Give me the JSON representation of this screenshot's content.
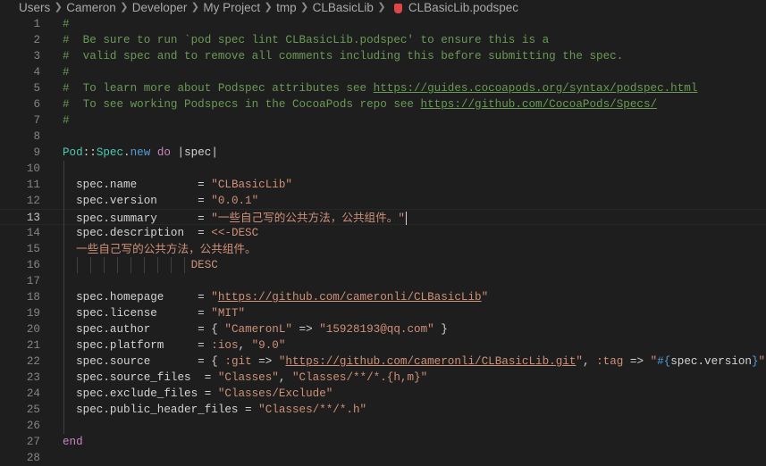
{
  "breadcrumb": {
    "items": [
      "Users",
      "Cameron",
      "Developer",
      "My Project",
      "tmp",
      "CLBasicLib"
    ],
    "file": "CLBasicLib.podspec",
    "file_icon": "ruby-file-icon",
    "file_icon_color": "#e0454a"
  },
  "editor": {
    "current_line": 13,
    "lines": [
      {
        "n": "1",
        "html": "<span class='cm'>#</span>"
      },
      {
        "n": "2",
        "html": "<span class='cm'>#  Be sure to run `pod spec lint CLBasicLib.podspec' to ensure this is a</span>"
      },
      {
        "n": "3",
        "html": "<span class='cm'>#  valid spec and to remove all comments including this before submitting the spec.</span>"
      },
      {
        "n": "4",
        "html": "<span class='cm'>#</span>"
      },
      {
        "n": "5",
        "html": "<span class='cm'>#  To learn more about Podspec attributes see </span><span class='url'>https://guides.cocoapods.org/syntax/podspec.html</span>"
      },
      {
        "n": "6",
        "html": "<span class='cm'>#  To see working Podspecs in the CocoaPods repo see </span><span class='url'>https://github.com/CocoaPods/Specs/</span>"
      },
      {
        "n": "7",
        "html": "<span class='cm'>#</span>"
      },
      {
        "n": "8",
        "html": ""
      },
      {
        "n": "9",
        "html": "<span class='cls'>Pod</span>::<span class='cls'>Spec</span>.<span class='blue'>new</span> <span class='kw'>do</span> |spec|"
      },
      {
        "n": "10",
        "html": ""
      },
      {
        "n": "11",
        "html": "  spec.name         = <span class='str'>\"CLBasicLib\"</span>"
      },
      {
        "n": "12",
        "html": "  spec.version      = <span class='str'>\"0.0.1\"</span>"
      },
      {
        "n": "13",
        "html": "  spec.summary      = <span class='str'>\"<span class='cjk'>一些自己写的公共方法，公共组件。</span>\"</span><span class='caret'></span>"
      },
      {
        "n": "14",
        "html": "  spec.description  = <span class='str'>&lt;&lt;-DESC</span>"
      },
      {
        "n": "15",
        "html": "<span class='str'>  <span class='cjk'>一些自己写的公共方法，公共组件。</span></span>"
      },
      {
        "n": "16",
        "html": "<span class='str'>                   DESC</span>"
      },
      {
        "n": "17",
        "html": ""
      },
      {
        "n": "18",
        "html": "  spec.homepage     = <span class='str'>\"</span><span class='strurl'>https://github.com/cameronli/CLBasicLib</span><span class='str'>\"</span>"
      },
      {
        "n": "19",
        "html": "  spec.license      = <span class='str'>\"MIT\"</span>"
      },
      {
        "n": "20",
        "html": "  spec.author       = { <span class='str'>\"CameronL\"</span> =&gt; <span class='str'>\"15928193@qq.com\"</span> }"
      },
      {
        "n": "21",
        "html": "  spec.platform     = <span class='str'>:ios</span>, <span class='str'>\"9.0\"</span>"
      },
      {
        "n": "22",
        "html": "  spec.source       = { <span class='str'>:git</span> =&gt; <span class='str'>\"</span><span class='strurl'>https://github.com/cameronli/CLBasicLib.git</span><span class='str'>\"</span>, <span class='str'>:tag</span> =&gt; <span class='str'>\"</span><span class='interp'>#{</span>spec.version<span class='interp'>}</span><span class='str'>\"</span> }"
      },
      {
        "n": "23",
        "html": "  spec.source_files  = <span class='str'>\"Classes\"</span>, <span class='str'>\"Classes/**/*.{h,m}\"</span>"
      },
      {
        "n": "24",
        "html": "  spec.exclude_files = <span class='str'>\"Classes/Exclude\"</span>"
      },
      {
        "n": "25",
        "html": "  spec.public_header_files = <span class='str'>\"Classes/**/*.h\"</span>"
      },
      {
        "n": "26",
        "html": ""
      },
      {
        "n": "27",
        "html": "<span class='kw'>end</span>"
      },
      {
        "n": "28",
        "html": ""
      }
    ]
  },
  "colors": {
    "background": "#1e1e1e",
    "comment": "#6a9955",
    "string": "#ce9178",
    "keyword": "#c586c0",
    "class": "#4ec9b0",
    "line_number": "#858585"
  }
}
